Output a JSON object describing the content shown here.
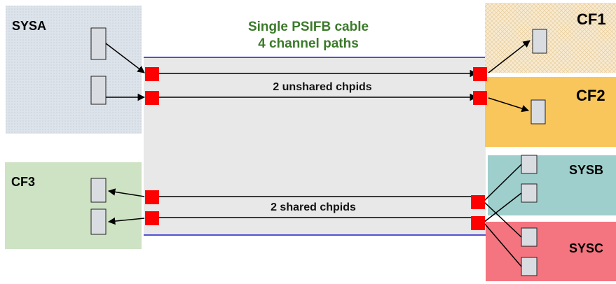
{
  "cable": {
    "title_line1": "Single PSIFB cable",
    "title_line2": "4 channel paths"
  },
  "links": {
    "unshared_label": "2 unshared chpids",
    "shared_label": "2 shared chpids"
  },
  "systems": {
    "sysa": "SYSA",
    "cf1": "CF1",
    "cf2": "CF2",
    "cf3": "CF3",
    "sysb": "SYSB",
    "sysc": "SYSC"
  },
  "colors": {
    "cable_fill": "#e8e8e8",
    "cable_border": "#1a1acc",
    "sysa_fill": "#dde3ea",
    "cf1_fill": "#f5e6c8",
    "cf2_fill": "#f9c65c",
    "cf3_fill": "#cde3c4",
    "sysb_fill": "#9fcfcc",
    "sysc_fill": "#f4757f",
    "port": "#ff0000",
    "title_text": "#3b7a2a"
  }
}
